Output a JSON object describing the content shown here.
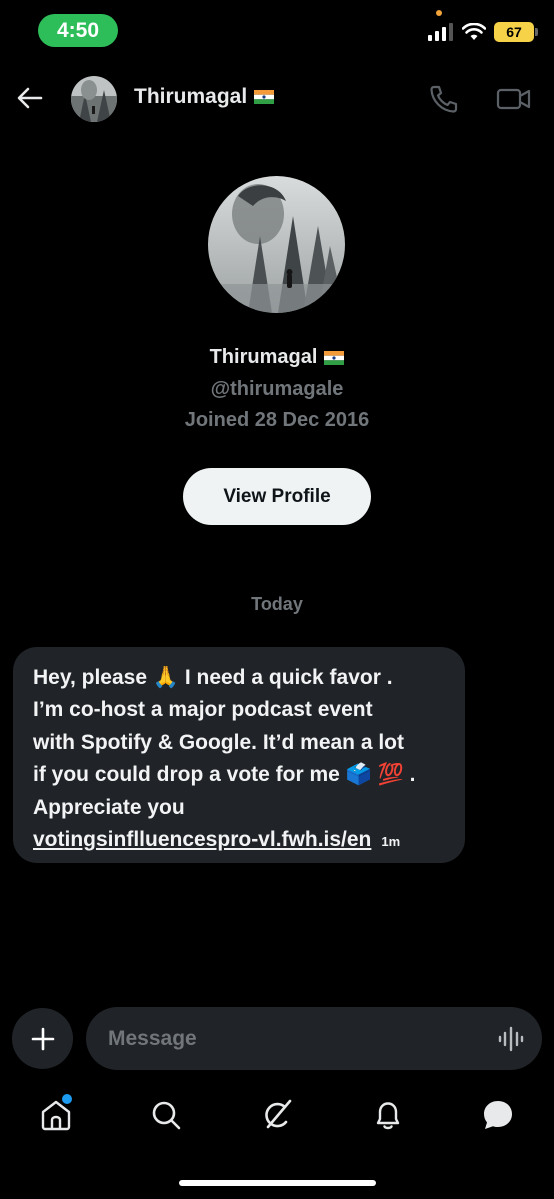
{
  "status_bar": {
    "time": "4:50",
    "battery": "67",
    "colors": {
      "time_pill": "#2dbe5a",
      "battery": "#f5d247",
      "privacy_dot": "#f2a33a"
    }
  },
  "header": {
    "name": "Thirumagal",
    "flag": "india-flag-icon"
  },
  "profile": {
    "name": "Thirumagal",
    "handle": "@thirumagale",
    "joined": "Joined 28 Dec 2016",
    "view_profile_label": "View Profile"
  },
  "conversation": {
    "day_label": "Today",
    "messages": [
      {
        "lines": [
          "Hey, please 🙏 I need a quick favor .",
          "I’m co-host a major podcast event",
          "with Spotify & Google. It’d mean a lot",
          "if you could drop a vote for me 🗳️ 💯 .",
          "Appreciate you"
        ],
        "link": "votingsinflluencespro-vl.fwh.is/en",
        "time": "1m"
      }
    ]
  },
  "composer": {
    "placeholder": "Message"
  },
  "nav": {
    "items": [
      "home-icon",
      "search-icon",
      "grok-icon",
      "notifications-icon",
      "messages-icon"
    ],
    "accent": "#1d9bf0"
  }
}
